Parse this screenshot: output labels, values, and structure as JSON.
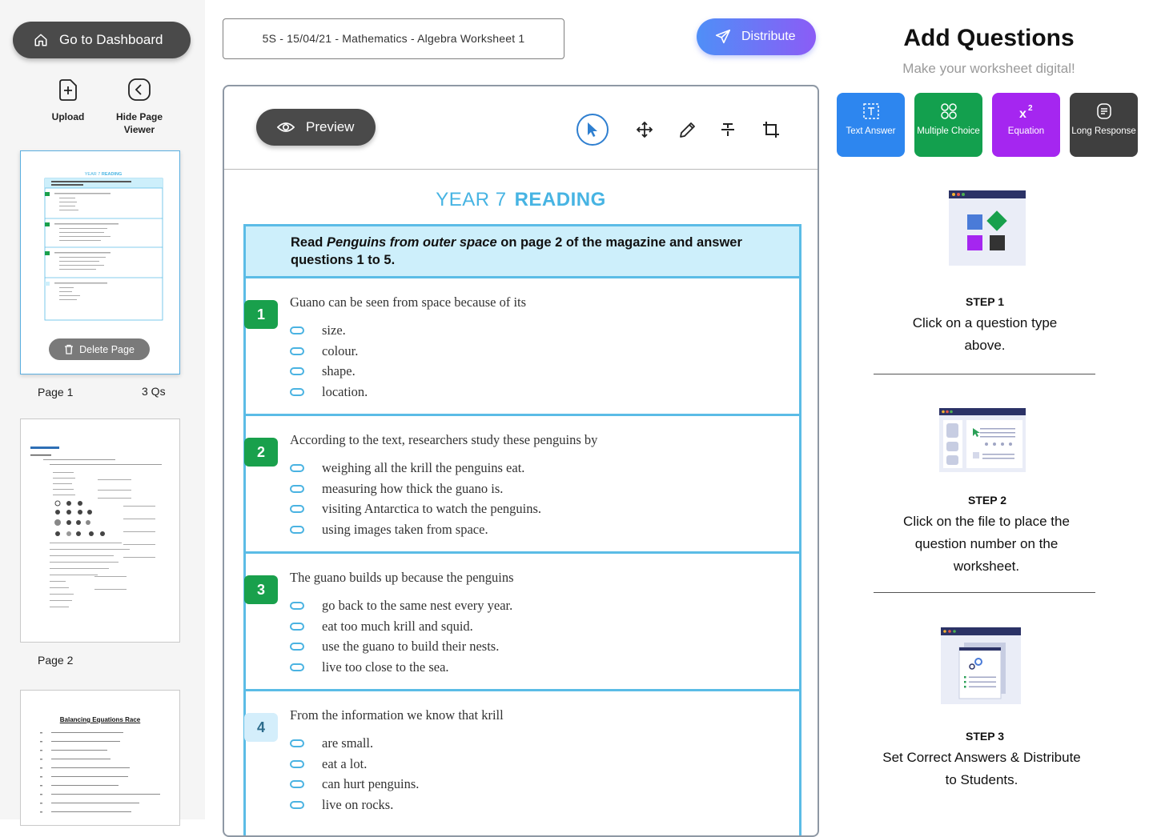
{
  "sidebar": {
    "dashboard_label": "Go to Dashboard",
    "tools": [
      {
        "label": "Upload",
        "icon": "upload-icon"
      },
      {
        "label": "Hide Page Viewer",
        "icon": "hide-viewer-icon"
      }
    ],
    "pages": [
      {
        "label": "Page 1",
        "count": "3 Qs"
      },
      {
        "label": "Page 2"
      }
    ],
    "delete_label": "Delete Page",
    "thumb3_title": "Balancing Equations Race"
  },
  "header": {
    "worksheet_title": "5S - 15/04/21 - Mathematics - Algebra Worksheet 1",
    "distribute_label": "Distribute"
  },
  "canvas": {
    "preview_label": "Preview",
    "tools": [
      "cursor-icon",
      "move-icon",
      "pencil-icon",
      "strikethrough-icon",
      "crop-icon"
    ],
    "worksheet": {
      "title_a": "YEAR 7",
      "title_b": "READING",
      "instruction_pre": "Read ",
      "instruction_em": "Penguins from outer space",
      "instruction_post": " on page 2 of the magazine and answer questions 1 to 5.",
      "questions": [
        {
          "num": "1",
          "text": "Guano can be seen from space because of its",
          "options": [
            "size.",
            "colour.",
            "shape.",
            "location."
          ]
        },
        {
          "num": "2",
          "text": "According to the text, researchers study these penguins by",
          "options": [
            "weighing all the krill the penguins eat.",
            "measuring how thick the guano is.",
            "visiting Antarctica to watch the penguins.",
            "using images taken from space."
          ]
        },
        {
          "num": "3",
          "text": "The guano builds up because the penguins",
          "options": [
            "go back to the same nest every year.",
            "eat too much krill and squid.",
            "use the guano to build their nests.",
            "live too close to the sea."
          ]
        },
        {
          "num": "4",
          "text": "From the information we know that krill",
          "options": [
            "are small.",
            "eat a lot.",
            "can hurt penguins.",
            "live on rocks."
          ]
        }
      ]
    }
  },
  "panel": {
    "title": "Add Questions",
    "subtitle": "Make your worksheet digital!",
    "types": [
      {
        "label": "Text Answer",
        "color": "#2d86ef",
        "icon": "text-answer-icon"
      },
      {
        "label": "Multiple Choice",
        "color": "#13a04e",
        "icon": "multiple-choice-icon"
      },
      {
        "label": "Equation",
        "color": "#a526f0",
        "icon": "equation-icon"
      },
      {
        "label": "Long Response",
        "color": "#3f3f3f",
        "icon": "long-response-icon"
      }
    ],
    "steps": [
      {
        "heading": "STEP 1",
        "text": "Click on a question type above."
      },
      {
        "heading": "STEP 2",
        "text": "Click on the file to place the question number on the worksheet."
      },
      {
        "heading": "STEP 3",
        "text": "Set Correct Answers & Distribute to Students."
      }
    ]
  }
}
